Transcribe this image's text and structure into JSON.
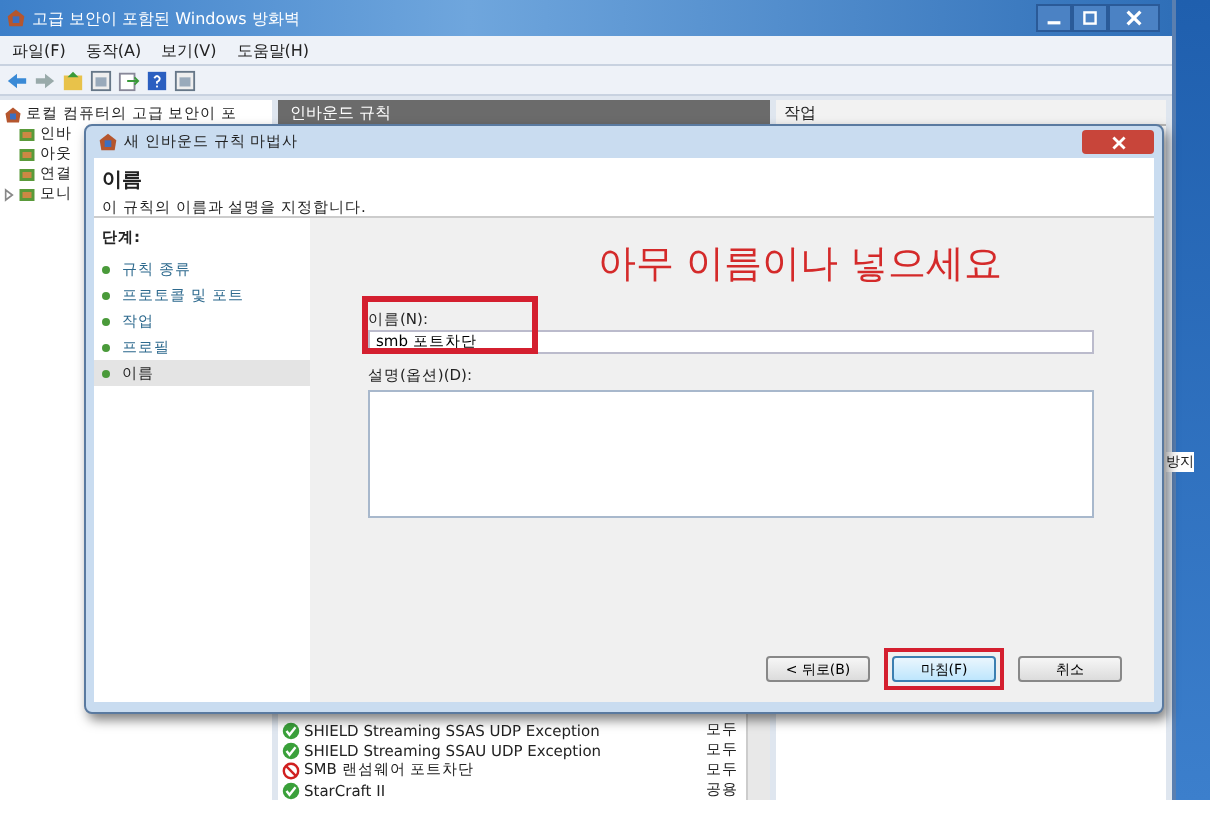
{
  "main_window": {
    "title": "고급 보안이 포함된 Windows 방화벽",
    "menu": [
      "파일(F)",
      "동작(A)",
      "보기(V)",
      "도움말(H)"
    ],
    "tree": {
      "root": "로컬 컴퓨터의 고급 보안이 포",
      "items": [
        {
          "label": "인바",
          "expandable": false
        },
        {
          "label": "아웃",
          "expandable": false
        },
        {
          "label": "연결",
          "expandable": false
        },
        {
          "label": "모니",
          "expandable": true
        }
      ]
    },
    "rules_pane": {
      "header": "인바운드 규칙",
      "rows": [
        {
          "name": "SHIELD Streaming SSAS UDP Exception",
          "profile": "모두",
          "kind": "allow"
        },
        {
          "name": "SHIELD Streaming SSAU UDP Exception",
          "profile": "모두",
          "kind": "allow"
        },
        {
          "name": "SMB 랜섬웨어 포트차단",
          "profile": "모두",
          "kind": "block"
        },
        {
          "name": "StarCraft II",
          "profile": "공용",
          "kind": "allow"
        }
      ]
    },
    "actions_pane": {
      "header": "작업"
    },
    "side_text": "방지"
  },
  "dialog": {
    "title": "새 인바운드 규칙 마법사",
    "heading": "이름",
    "subtitle": "이 규칙의 이름과 설명을 지정합니다.",
    "steps_label": "단계:",
    "steps": [
      {
        "label": "규칙 종류",
        "selected": false
      },
      {
        "label": "프로토콜 및 포트",
        "selected": false
      },
      {
        "label": "작업",
        "selected": false
      },
      {
        "label": "프로필",
        "selected": false
      },
      {
        "label": "이름",
        "selected": true
      }
    ],
    "annotation": "아무 이름이나 넣으세요",
    "name_label": "이름(N):",
    "name_value": "smb 포트차단",
    "description_label": "설명(옵션)(D):",
    "buttons": [
      {
        "label": "< 뒤로(B)",
        "highlighted": false
      },
      {
        "label": "마침(F)",
        "highlighted": true
      },
      {
        "label": "취소",
        "highlighted": false
      }
    ]
  }
}
